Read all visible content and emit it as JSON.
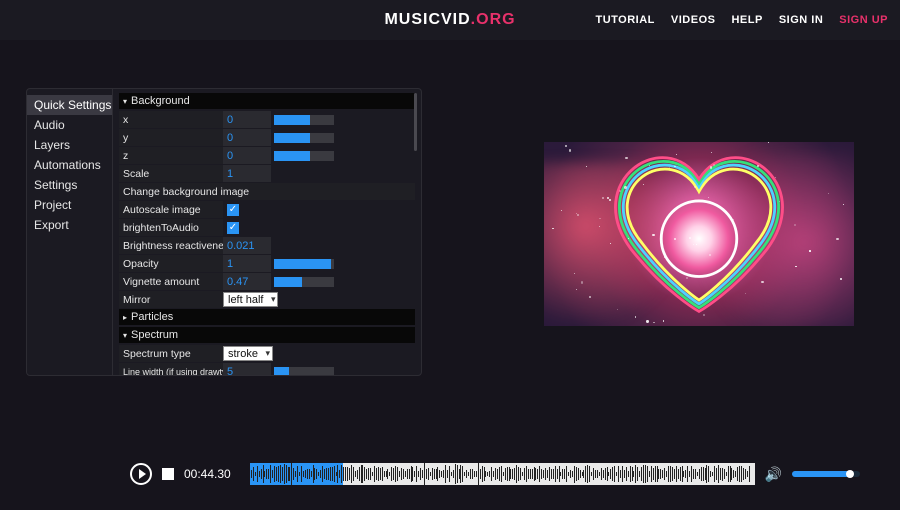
{
  "header": {
    "logo_white": "MUSICVID",
    "logo_pink": ".ORG",
    "nav": {
      "tutorial": "TUTORIAL",
      "videos": "VIDEOS",
      "help": "HELP",
      "signin": "SIGN IN",
      "signup": "SIGN UP"
    }
  },
  "sidebar": {
    "items": [
      {
        "label": "Quick Settings",
        "selected": true
      },
      {
        "label": "Audio"
      },
      {
        "label": "Layers"
      },
      {
        "label": "Automations"
      },
      {
        "label": "Settings"
      },
      {
        "label": "Project"
      },
      {
        "label": "Export"
      }
    ]
  },
  "sections": {
    "background": {
      "title": "Background",
      "x": {
        "label": "x",
        "value": "0",
        "fill": 0.6
      },
      "y": {
        "label": "y",
        "value": "0",
        "fill": 0.6
      },
      "z": {
        "label": "z",
        "value": "0",
        "fill": 0.6
      },
      "scale": {
        "label": "Scale",
        "value": "1"
      },
      "changeImage": {
        "label": "Change background image"
      },
      "autoscale": {
        "label": "Autoscale image",
        "checked": true
      },
      "brightenToAudio": {
        "label": "brightenToAudio",
        "checked": true
      },
      "brightnessReactiveness": {
        "label": "Brightness reactiveness",
        "value": "0.021"
      },
      "opacity": {
        "label": "Opacity",
        "value": "1",
        "fill": 0.95
      },
      "vignette": {
        "label": "Vignette amount",
        "value": "0.47",
        "fill": 0.47
      },
      "mirror": {
        "label": "Mirror",
        "selected": "left half"
      }
    },
    "particles": {
      "title": "Particles"
    },
    "spectrum": {
      "title": "Spectrum",
      "type": {
        "label": "Spectrum type",
        "selected": "stroke"
      },
      "lineWidth": {
        "label": "Line width (if using drawtype stroke)",
        "value": "5",
        "fill": 0.25
      }
    }
  },
  "playbar": {
    "time": "00:44.30",
    "progress_pct": 18.5,
    "volume_pct": 85
  },
  "colors": {
    "accent": "#2a94f4",
    "pink": "#e8316b"
  }
}
